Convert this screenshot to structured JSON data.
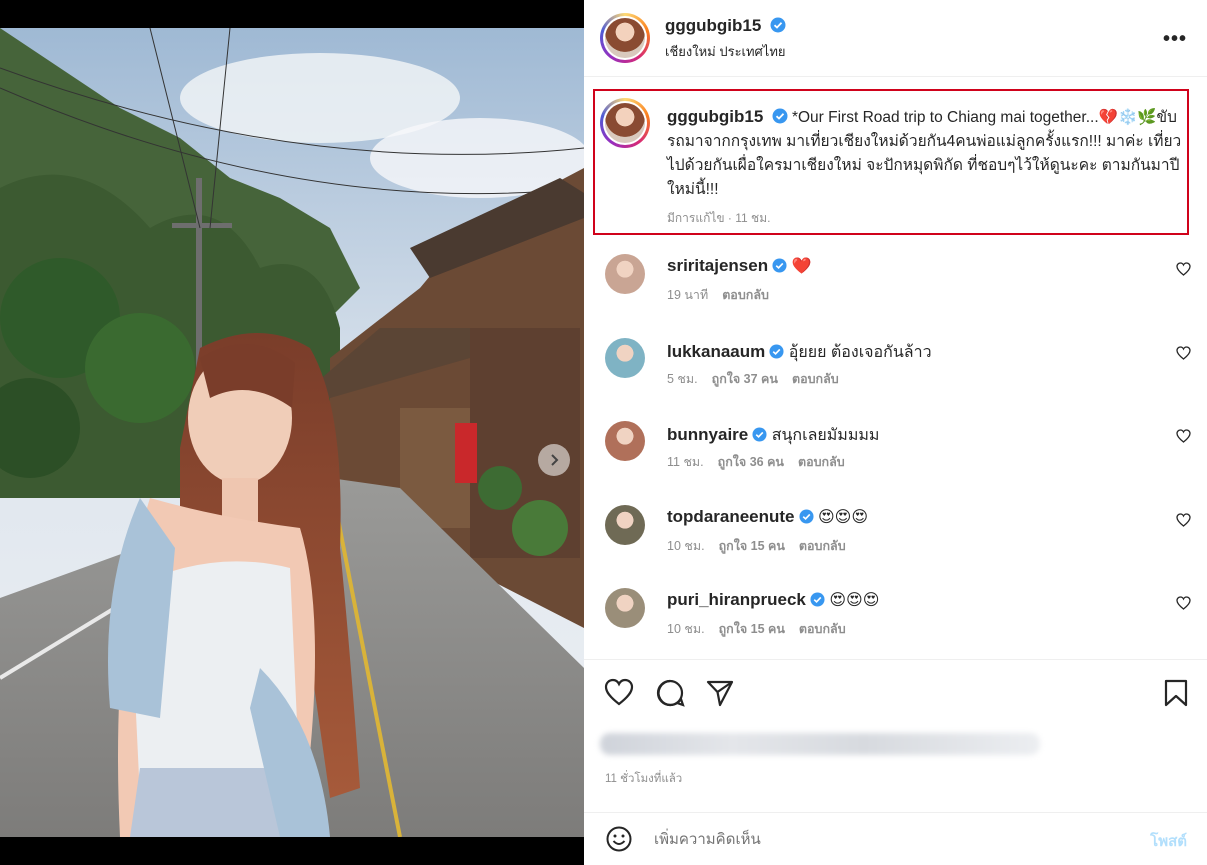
{
  "post": {
    "username": "gggubgib15",
    "location": "เชียงใหม่ ประเทศไทย",
    "caption": "*Our First Road trip to Chiang mai together...💔❄️🌿ขับรถมาจากกรุงเทพ มาเที่ยวเชียงใหม่ด้วยกัน4คนพ่อแม่ลูกครั้งแรก!!! มาค่ะ เที่ยวไปด้วยกันเผื่อใครมาเชียงใหม่ จะปักหมุดพิกัด ที่ชอบๆไว้ให้ดูนะคะ ตามกันมาปีใหม่นี้!!!",
    "caption_meta": "มีการแก้ไข · 11 ชม.",
    "time_ago": "11 ชั่วโมงที่แล้ว"
  },
  "comments": [
    {
      "username": "sriritajensen",
      "text": "❤️",
      "time": "19 นาที",
      "likes": "",
      "reply": "ตอบกลับ",
      "avatar_color": "#c9a594"
    },
    {
      "username": "lukkanaaum",
      "text": "อุ้ยยย ต้องเจอกันล้าว",
      "time": "5 ชม.",
      "likes": "ถูกใจ 37 คน",
      "reply": "ตอบกลับ",
      "avatar_color": "#7fb3c4"
    },
    {
      "username": "bunnyaire",
      "text": "สนุกเลยมัมมมม",
      "time": "11 ชม.",
      "likes": "ถูกใจ 36 คน",
      "reply": "ตอบกลับ",
      "avatar_color": "#b0705a"
    },
    {
      "username": "topdaraneenute",
      "text": "😍😍😍",
      "time": "10 ชม.",
      "likes": "ถูกใจ 15 คน",
      "reply": "ตอบกลับ",
      "avatar_color": "#6f6a55"
    },
    {
      "username": "puri_hiranprueck",
      "text": "😍😍😍",
      "time": "10 ชม.",
      "likes": "ถูกใจ 15 คน",
      "reply": "ตอบกลับ",
      "avatar_color": "#9a8e79"
    }
  ],
  "composer": {
    "placeholder": "เพิ่มความคิดเห็น",
    "post_label": "โพสต์"
  },
  "icons": {
    "more": "more-icon",
    "like": "heart-icon",
    "comment": "comment-icon",
    "share": "share-icon",
    "save": "bookmark-icon",
    "emoji": "emoji-icon",
    "next": "chevron-right-icon"
  },
  "colors": {
    "highlight_border": "#d0021b",
    "verified": "#3897f0",
    "post_button": "#b2dffc"
  }
}
